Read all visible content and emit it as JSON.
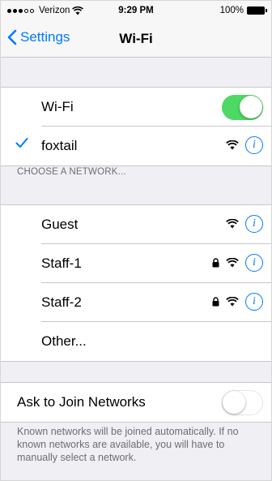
{
  "status_bar": {
    "carrier": "Verizon",
    "time": "9:29 PM",
    "battery": "100%"
  },
  "nav": {
    "back_label": "Settings",
    "title": "Wi-Fi"
  },
  "wifi": {
    "label": "Wi-Fi",
    "enabled": true,
    "connected_network": "foxtail"
  },
  "section_header": "CHOOSE A NETWORK...",
  "networks": [
    {
      "name": "Guest",
      "locked": false
    },
    {
      "name": "Staff-1",
      "locked": true
    },
    {
      "name": "Staff-2",
      "locked": true
    }
  ],
  "other_label": "Other...",
  "ask_to_join": {
    "label": "Ask to Join Networks",
    "enabled": false
  },
  "footer": "Known networks will be joined automatically. If no known networks are available, you will have to manually select a network.",
  "colors": {
    "accent": "#007aff",
    "toggle_on": "#4cd964"
  }
}
